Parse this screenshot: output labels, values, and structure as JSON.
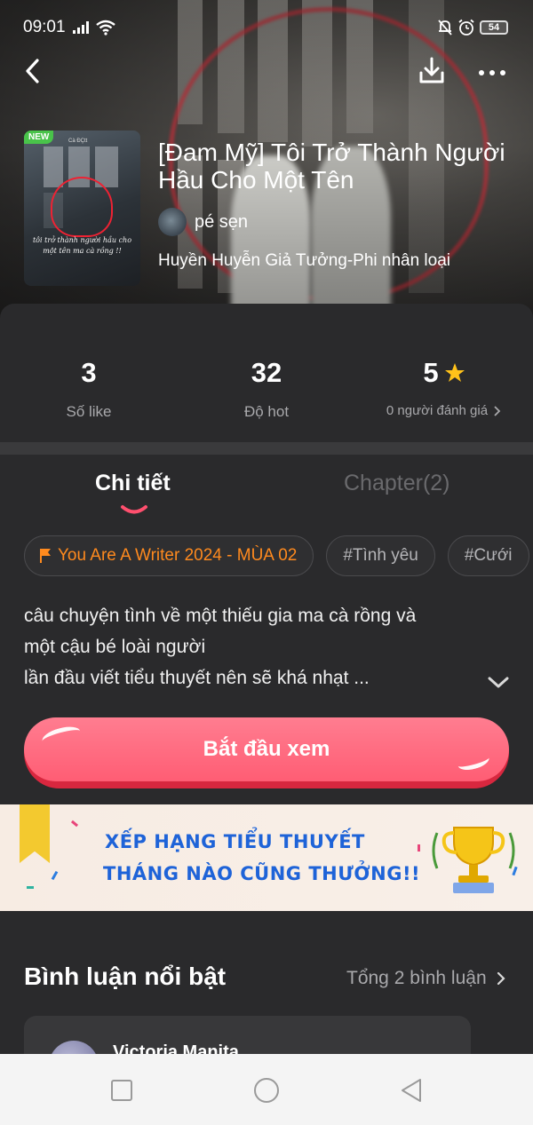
{
  "status_bar": {
    "time": "09:01",
    "battery": "54",
    "icons": [
      "signal-icon",
      "wifi-icon",
      "bell-off-icon",
      "alarm-icon",
      "battery-icon"
    ]
  },
  "top_bar": {
    "icons": [
      "back-icon",
      "download-icon",
      "more-icon"
    ]
  },
  "book": {
    "cover_badge": "NEW",
    "cover_small_title": "Cà ĐÇtt",
    "cover_text": "tôi trở thành người hầu cho một tên ma cà rồng !!",
    "title": "[Đam Mỹ] Tôi Trở Thành Người Hầu Cho Một Tên",
    "author": "pé sẹn",
    "genres": "Huyền Huyễn Giả Tưởng-Phi nhân loại"
  },
  "stats": [
    {
      "value": "3",
      "label": "Số like"
    },
    {
      "value": "32",
      "label": "Độ hot"
    },
    {
      "value": "5",
      "label": "0 người đánh giá"
    }
  ],
  "tabs": {
    "detail": "Chi tiết",
    "chapters": "Chapter(2)"
  },
  "tags": [
    "You Are A Writer 2024 - MÙA 02",
    "#Tình yêu",
    "#Cưới"
  ],
  "description": {
    "line1": "câu chuyện tình về một thiếu gia ma cà rồng và",
    "line2": "một cậu bé loài người",
    "line3": "lần đầu viết tiểu thuyết nên sẽ khá nhạt ..."
  },
  "start_button": "Bắt đầu xem",
  "banner": {
    "line1": "XẾP HẠNG TIỂU THUYẾT",
    "line2": "THÁNG NÀO CŨNG THƯỞNG!!"
  },
  "comments": {
    "header": "Bình luận nổi bật",
    "total": "Tổng 2 bình luận",
    "first_author": "Victoria Manita"
  },
  "colors": {
    "accent_pink": "#ff5d74",
    "tag_orange": "#ff8a1e",
    "background": "#2a2a2c",
    "banner_blue": "#1e63d8"
  }
}
